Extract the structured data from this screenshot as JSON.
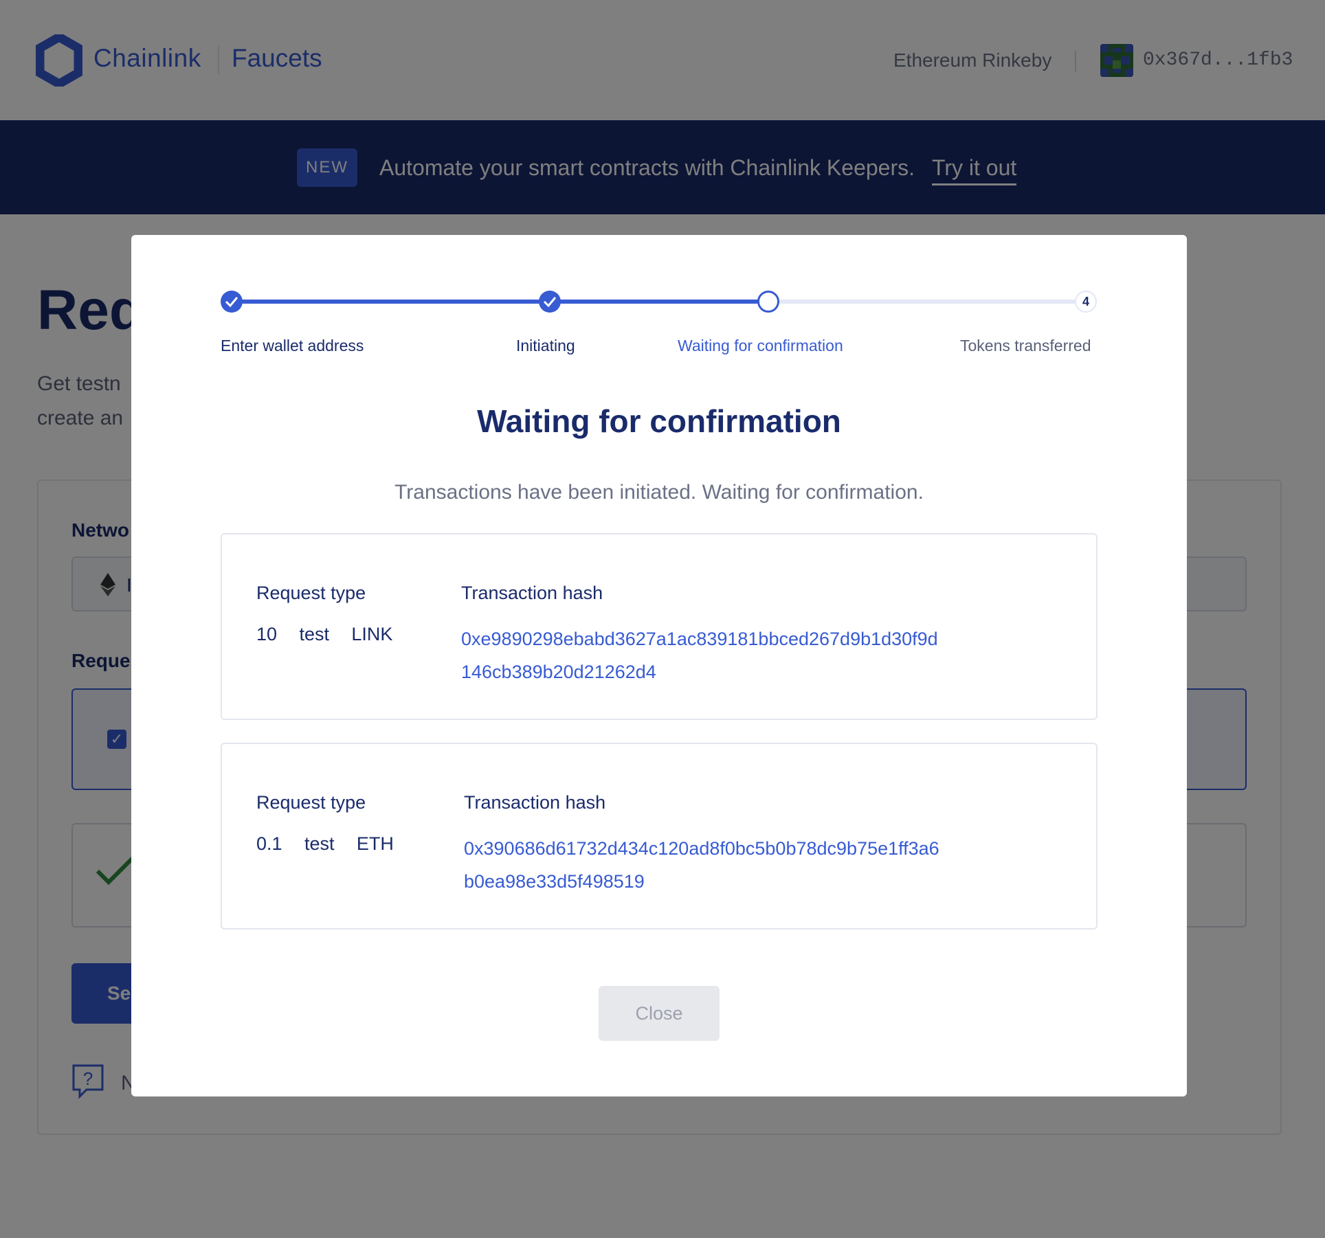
{
  "header": {
    "brand": "Chainlink",
    "brand_sub": "Faucets",
    "network": "Ethereum Rinkeby",
    "address": "0x367d...1fb3"
  },
  "banner": {
    "badge": "NEW",
    "text": "Automate your smart contracts with Chainlink Keepers.",
    "link": "Try it out"
  },
  "background": {
    "title": "Req",
    "desc_line1": "Get testn",
    "desc_line2": "create an",
    "network_label": "Netwo",
    "network_value": "I",
    "request_label": "Reques",
    "send_label": "Se",
    "help_text": "N"
  },
  "modal": {
    "steps": [
      {
        "label": "Enter wallet address",
        "state": "done"
      },
      {
        "label": "Initiating",
        "state": "done"
      },
      {
        "label": "Waiting for confirmation",
        "state": "current"
      },
      {
        "label": "Tokens transferred",
        "state": "future",
        "number": "4"
      }
    ],
    "title": "Waiting for confirmation",
    "subtitle": "Transactions have been initiated. Waiting for confirmation.",
    "transactions": [
      {
        "request_type_label": "Request type",
        "amount": "10",
        "token_prefix": "test",
        "token": "LINK",
        "hash_label": "Transaction hash",
        "hash": "0xe9890298ebabd3627a1ac839181bbced267d9b1d30f9d146cb389b20d21262d4"
      },
      {
        "request_type_label": "Request type",
        "amount": "0.1",
        "token_prefix": "test",
        "token": "ETH",
        "hash_label": "Transaction hash",
        "hash": "0x390686d61732d434c120ad8f0bc5b0b78dc9b75e1ff3a6b0ea98e33d5f498519"
      }
    ],
    "close_label": "Close"
  },
  "colors": {
    "brand_blue": "#375bd2",
    "navy": "#1a2b6b",
    "banner_bg": "#1a2b6b",
    "overlay": "rgba(0,0,0,0.5)"
  }
}
